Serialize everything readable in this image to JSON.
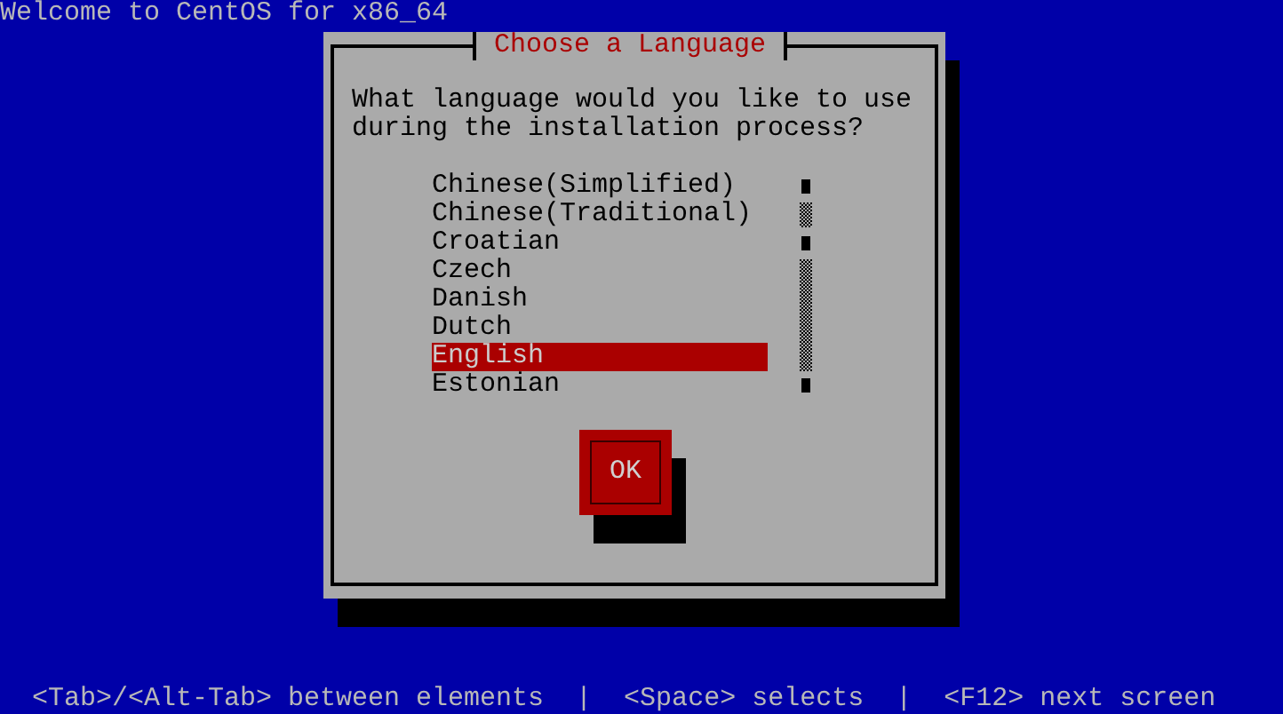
{
  "screen": {
    "title": "Welcome to CentOS for x86_64"
  },
  "dialog": {
    "title": "Choose a Language",
    "question": "What language would you like to use during the installation process?",
    "languages": [
      {
        "label": "Chinese(Simplified)",
        "selected": false
      },
      {
        "label": "Chinese(Traditional)",
        "selected": false
      },
      {
        "label": "Croatian",
        "selected": false
      },
      {
        "label": "Czech",
        "selected": false
      },
      {
        "label": "Danish",
        "selected": false
      },
      {
        "label": "Dutch",
        "selected": false
      },
      {
        "label": "English",
        "selected": true
      },
      {
        "label": "Estonian",
        "selected": false
      }
    ],
    "buttons": [
      "OK"
    ]
  },
  "status_bar": "  <Tab>/<Alt-Tab> between elements  |  <Space> selects  |  <F12> next screen"
}
